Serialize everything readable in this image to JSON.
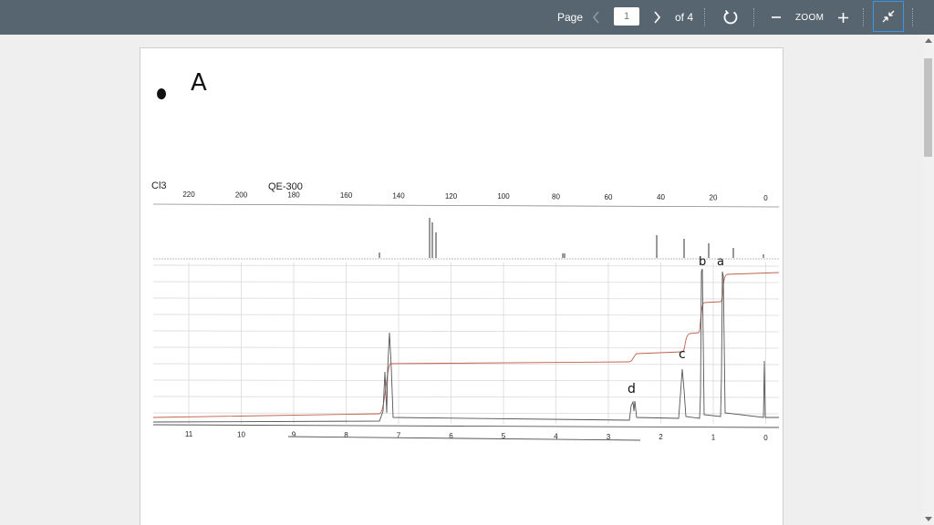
{
  "toolbar": {
    "page_label": "Page",
    "current_page": "1",
    "total_pages_label": "of 4",
    "zoom_label": "ZOOM",
    "icons": {
      "prev": "chevron-left-icon",
      "next": "chevron-right-icon",
      "rotate": "rotate-icon",
      "zoom_out": "minus-icon",
      "zoom_in": "plus-icon",
      "collapse": "collapse-icon"
    },
    "colors": {
      "bar": "#56656f",
      "focus": "#3b97e3"
    }
  },
  "document": {
    "compound_label": "A",
    "solvent_fragment": "Cl3",
    "instrument": "QE-300",
    "c13_scale_ticks": [
      "220",
      "200",
      "180",
      "160",
      "140",
      "120",
      "100",
      "80",
      "60",
      "40",
      "20",
      "0"
    ],
    "h1_scale_ticks": [
      "11",
      "10",
      "9",
      "8",
      "7",
      "6",
      "5",
      "4",
      "3",
      "2",
      "1",
      "0"
    ],
    "peak_labels": [
      "b",
      "a",
      "c",
      "d"
    ]
  }
}
